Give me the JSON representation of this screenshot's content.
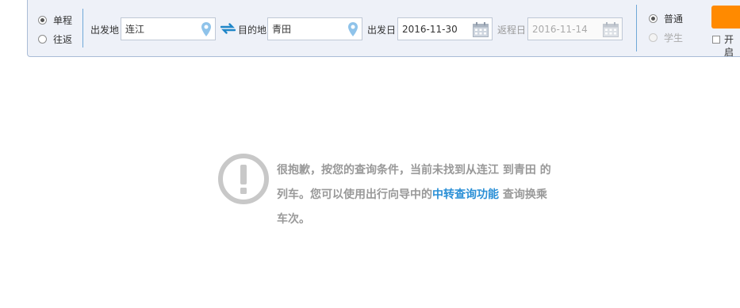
{
  "trip_type": {
    "one_way_label": "单程",
    "round_trip_label": "往返",
    "selected": "one_way"
  },
  "search": {
    "from_label": "出发地",
    "from_value": "连江",
    "to_label": "目的地",
    "to_value": "青田",
    "depart_label": "出发日",
    "depart_value": "2016-11-30",
    "return_label": "返程日",
    "return_value": "2016-11-14"
  },
  "ticket_type": {
    "normal_label": "普通",
    "student_label": "学生",
    "selected": "normal"
  },
  "extra": {
    "checkbox_label": "开启"
  },
  "colors": {
    "accent_blue": "#2a8fd6",
    "query_button": "#ff8a00",
    "bar_background": "#eef1f8"
  },
  "message": {
    "line1_text": "很抱歉，按您的查询条件，当前未找到从",
    "from_station": "连江",
    "line1_mid": " 到",
    "to_station": "青田",
    "line1_end": " 的",
    "line2_text": "列车。您可以使用出行向导中的",
    "link_text": "中转查询功能",
    "line2_end": " 查询换乘",
    "line3_text": "车次。"
  }
}
